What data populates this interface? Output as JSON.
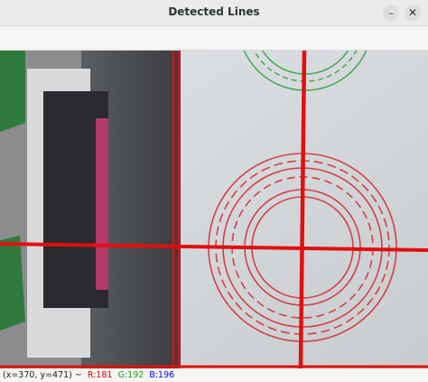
{
  "window": {
    "title": "Detected Lines",
    "minimize_icon": "minimize-icon",
    "close_icon": "close-icon"
  },
  "image": {
    "description_source": "camera frame with detected Hough lines",
    "line_color": "#e10f0f",
    "circle_colors": {
      "top": "#3aa64a",
      "bottom": "#d04048"
    }
  },
  "status": {
    "position": "(x=370, y=471) ~",
    "r": "R:181",
    "g": "G:192",
    "b": "B:196",
    "colors": {
      "r": "#e00000",
      "g": "#1a9a1a",
      "b": "#0000e0"
    }
  }
}
